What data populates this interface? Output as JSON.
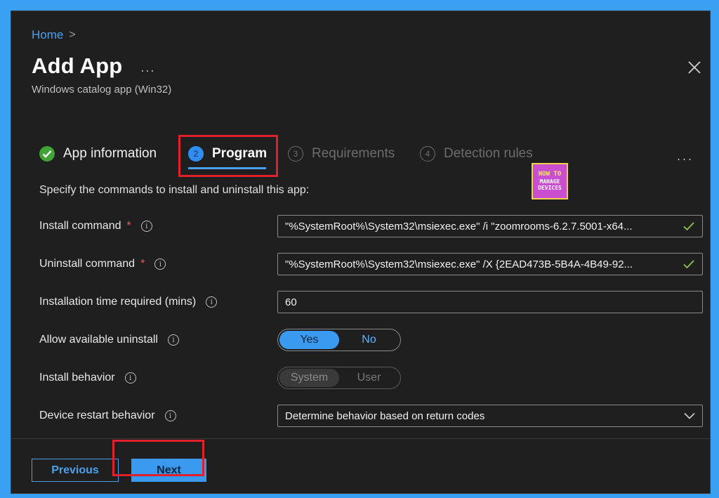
{
  "breadcrumb": {
    "home": "Home",
    "separator": ">"
  },
  "header": {
    "title": "Add App",
    "more": "...",
    "subtitle": "Windows catalog app (Win32)",
    "close_icon": "close-icon"
  },
  "steps": [
    {
      "number": "✓",
      "label": "App information",
      "state": "complete"
    },
    {
      "number": "2",
      "label": "Program",
      "state": "active"
    },
    {
      "number": "3",
      "label": "Requirements",
      "state": "inactive"
    },
    {
      "number": "4",
      "label": "Detection rules",
      "state": "inactive"
    }
  ],
  "steps_more": "...",
  "logo": {
    "line1": "HOW TO",
    "line2": "MANAGE",
    "line3": "DEVICES"
  },
  "description": "Specify the commands to install and uninstall this app:",
  "form": {
    "install_command": {
      "label": "Install command",
      "required": "*",
      "value": "\"%SystemRoot%\\System32\\msiexec.exe\" /i \"zoomrooms-6.2.7.5001-x64..."
    },
    "uninstall_command": {
      "label": "Uninstall command",
      "required": "*",
      "value": "\"%SystemRoot%\\System32\\msiexec.exe\" /X {2EAD473B-5B4A-4B49-92..."
    },
    "install_time": {
      "label": "Installation time required (mins)",
      "value": "60"
    },
    "allow_uninstall": {
      "label": "Allow available uninstall",
      "options": [
        "Yes",
        "No"
      ],
      "selected": "Yes"
    },
    "install_behavior": {
      "label": "Install behavior",
      "options": [
        "System",
        "User"
      ],
      "selected": "System"
    },
    "restart_behavior": {
      "label": "Device restart behavior",
      "value": "Determine behavior based on return codes"
    }
  },
  "footer": {
    "previous": "Previous",
    "next": "Next"
  },
  "colors": {
    "accent": "#3a9af0",
    "highlight": "#e0202a",
    "success": "#3fa435",
    "background": "#1f1f1f"
  }
}
